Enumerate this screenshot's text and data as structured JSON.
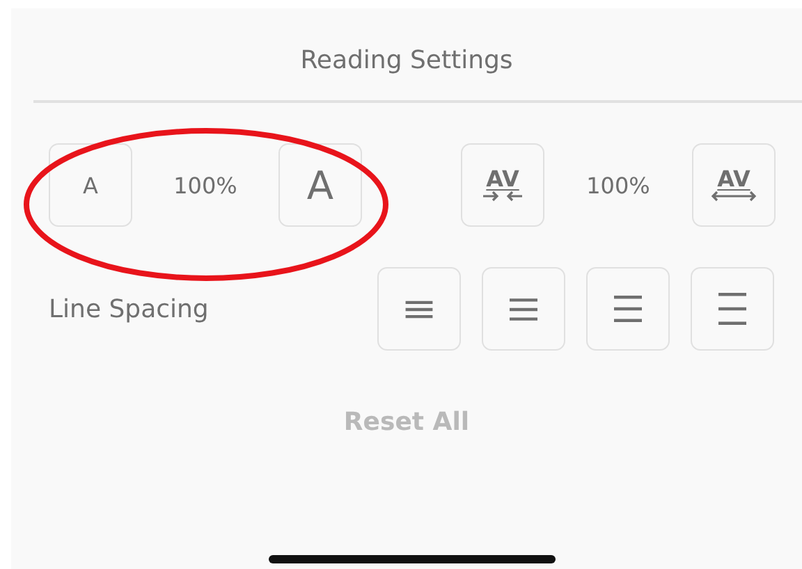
{
  "title": "Reading Settings",
  "font_size": {
    "smaller": "A",
    "reading": "100%",
    "larger": "A"
  },
  "character_spacing": {
    "tighter": "AV",
    "reading": "100%",
    "wider": "AV"
  },
  "line_spacing": {
    "label": "Line Spacing"
  },
  "reset_button": {
    "label": "Reset All",
    "disabled": true
  },
  "annotation": {
    "kind": "ellipse",
    "color": "#e8141b"
  }
}
